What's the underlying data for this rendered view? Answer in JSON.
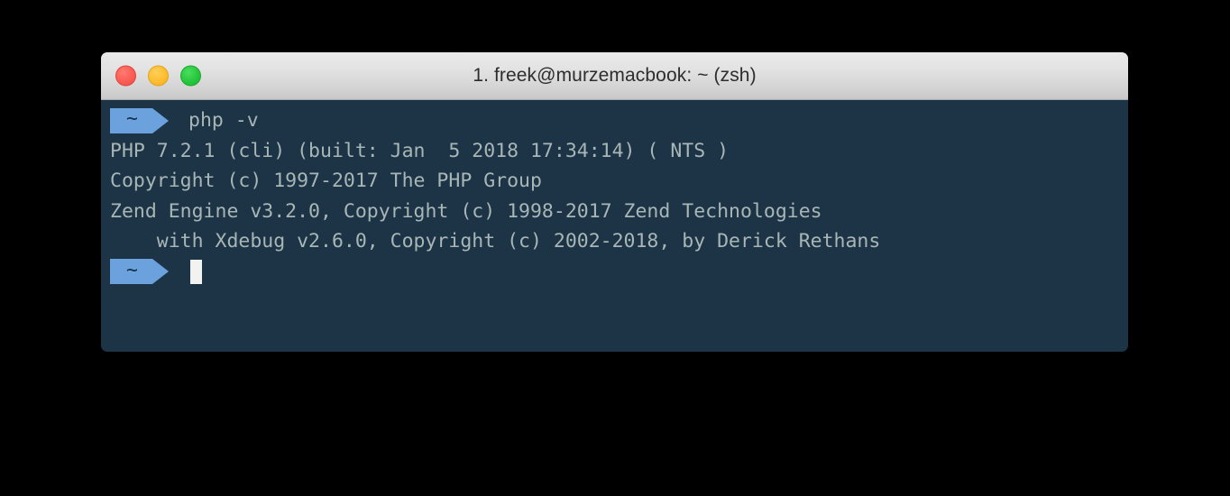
{
  "window": {
    "title": "1. freek@murzemacbook: ~ (zsh)",
    "controls": {
      "close_label": "close",
      "minimize_label": "minimize",
      "zoom_label": "zoom"
    }
  },
  "terminal": {
    "prompt_symbol": "~",
    "command": "php -v",
    "output_lines": [
      "PHP 7.2.1 (cli) (built: Jan  5 2018 17:34:14) ( NTS )",
      "Copyright (c) 1997-2017 The PHP Group",
      "Zend Engine v3.2.0, Copyright (c) 1998-2017 Zend Technologies",
      "    with Xdebug v2.6.0, Copyright (c) 2002-2018, by Derick Rethans"
    ],
    "cursor": "block"
  },
  "colors": {
    "desktop_background": "#000000",
    "terminal_background": "#1c3446",
    "terminal_text": "#a8b6b6",
    "prompt_badge": "#6ba2de",
    "prompt_badge_text": "#123048",
    "cursor": "#f2f2f0",
    "titlebar_text": "#2d2d2d",
    "close_button": "#fb5d54",
    "minimize_button": "#febd2f",
    "zoom_button": "#28c63e"
  }
}
